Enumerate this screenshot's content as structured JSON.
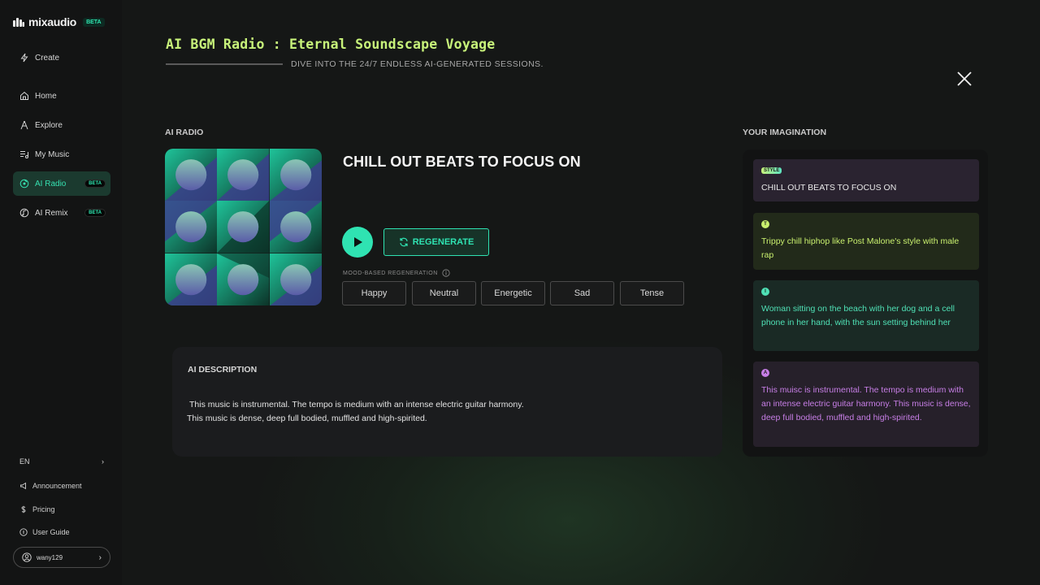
{
  "sidebar": {
    "brand": "mixaudio",
    "beta": "BETA",
    "create": "Create",
    "items": [
      {
        "label": "Home"
      },
      {
        "label": "Explore"
      },
      {
        "label": "My Music"
      },
      {
        "label": "AI Radio",
        "badge": "BETA"
      },
      {
        "label": "AI Remix",
        "badge": "BETA"
      }
    ],
    "language": "EN",
    "links": [
      "Announcement",
      "Pricing",
      "User Guide"
    ],
    "user": "wany129"
  },
  "header": {
    "title": "AI BGM Radio : Eternal Soundscape Voyage",
    "subtitle": "DIVE INTO THE 24/7 ENDLESS AI-GENERATED SESSIONS."
  },
  "radio": {
    "section_label": "AI RADIO",
    "track_title": "CHILL OUT BEATS TO FOCUS ON",
    "regenerate_label": "REGENERATE",
    "mood_label": "MOOD-BASED REGENERATION",
    "moods": [
      "Happy",
      "Neutral",
      "Energetic",
      "Sad",
      "Tense"
    ]
  },
  "description": {
    "title": "AI DESCRIPTION",
    "line1": "This music is instrumental. The tempo is medium with an intense electric guitar harmony.",
    "line2": "This music is dense, deep full bodied, muffled and high-spirited."
  },
  "imagination": {
    "section_label": "YOUR IMAGINATION",
    "cards": [
      {
        "badge": "STYLE",
        "text": "CHILL OUT BEATS TO FOCUS ON",
        "color": "#e8e8e8",
        "bg": "#2a2330"
      },
      {
        "badge": "T",
        "text": "Trippy chill hiphop like Post Malone's style with male rap",
        "color": "#c9f06e",
        "bg": "#222a1a"
      },
      {
        "badge": "I",
        "text": "Woman sitting on the beach with her dog and a cell phone in her hand, with the sun setting behind her",
        "color": "#4fe0b5",
        "bg": "#1a2a25"
      },
      {
        "badge": "A",
        "text": "This muisc is instrumental. The tempo is medium with an intense electric guitar harmony. This music is dense, deep full bodied, muffled and high-spirited.",
        "color": "#c77ee6",
        "bg": "#26202a"
      }
    ]
  },
  "colors": {
    "accent": "#2fe3b2",
    "title_green": "#c7f27a",
    "active_nav_bg": "#1b3a2f"
  }
}
